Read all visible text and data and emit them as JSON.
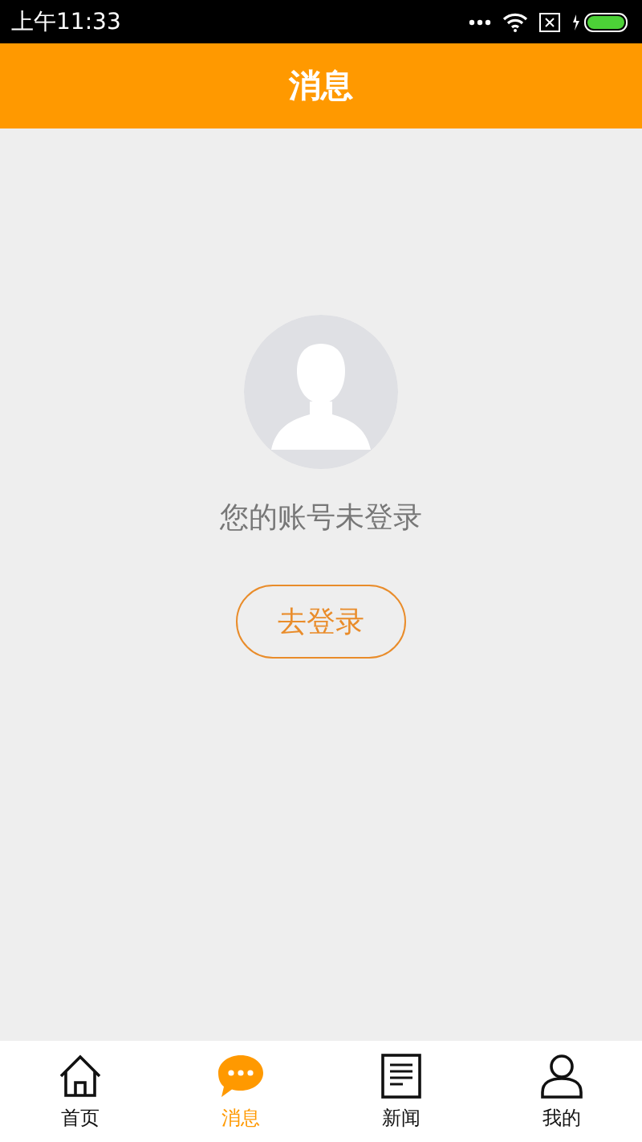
{
  "status_bar": {
    "time": "上午11:33"
  },
  "header": {
    "title": "消息"
  },
  "login_prompt": {
    "message": "您的账号未登录",
    "button": "去登录"
  },
  "tabs": [
    {
      "label": "首页",
      "kind": "home",
      "selected": false
    },
    {
      "label": "消息",
      "kind": "chat",
      "selected": true
    },
    {
      "label": "新闻",
      "kind": "news",
      "selected": false
    },
    {
      "label": "我的",
      "kind": "user",
      "selected": false
    }
  ]
}
